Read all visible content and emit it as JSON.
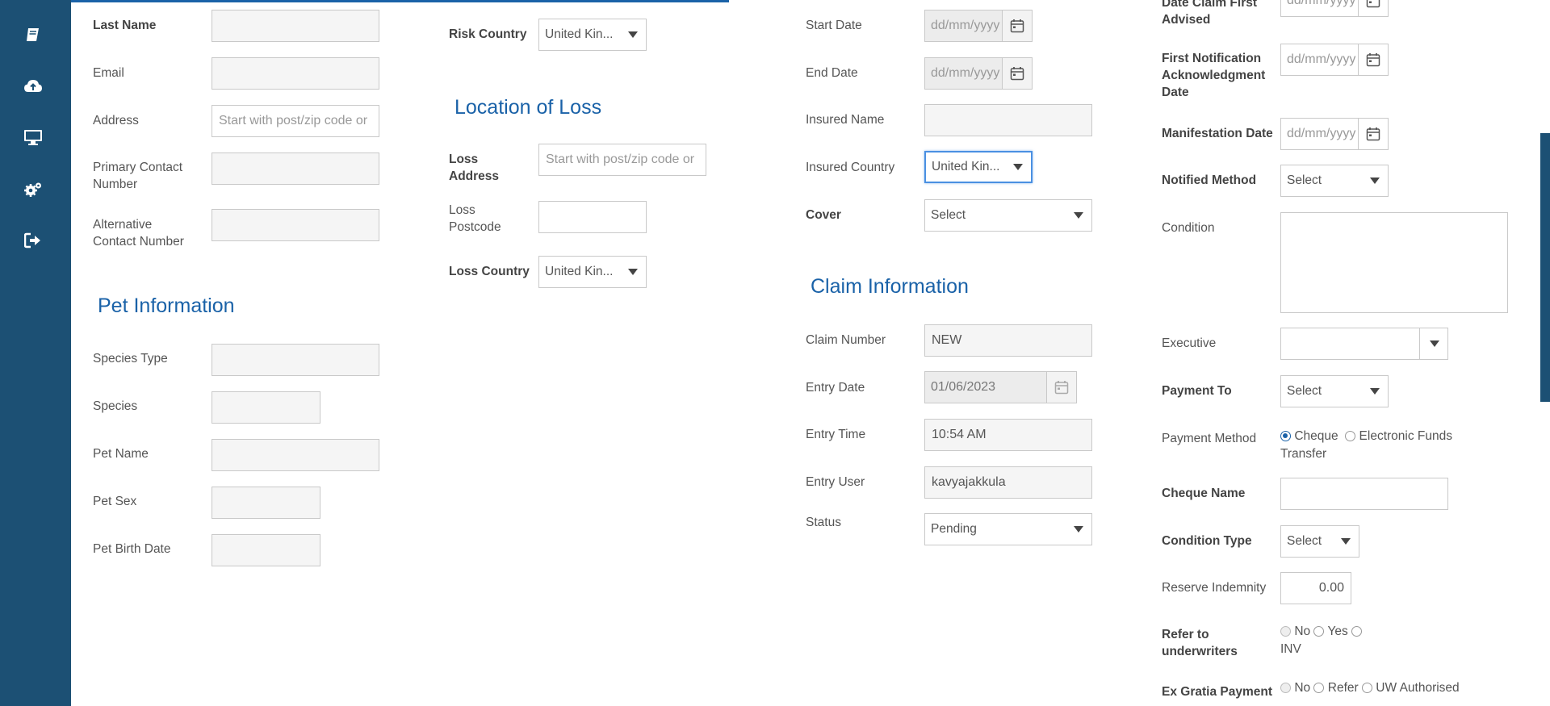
{
  "sidebar": {
    "items": [
      {
        "name": "claims-book-icon"
      },
      {
        "name": "cloud-upload-icon"
      },
      {
        "name": "monitor-icon"
      },
      {
        "name": "settings-gears-icon"
      },
      {
        "name": "sign-out-icon"
      }
    ]
  },
  "contact": {
    "last_name_label": "Last Name",
    "email_label": "Email",
    "address_label": "Address",
    "address_placeholder": "Start with post/zip code or",
    "primary_contact_label": "Primary Contact Number",
    "alternative_contact_label": "Alternative Contact Number"
  },
  "pet": {
    "title": "Pet Information",
    "species_type_label": "Species Type",
    "species_label": "Species",
    "pet_name_label": "Pet Name",
    "pet_sex_label": "Pet Sex",
    "pet_birth_date_label": "Pet Birth Date"
  },
  "risk": {
    "risk_country_label": "Risk Country",
    "risk_country_value": "United Kin..."
  },
  "loss": {
    "title": "Location of Loss",
    "loss_address_label": "Loss Address",
    "loss_address_placeholder": "Start with post/zip code or",
    "loss_postcode_label": "Loss Postcode",
    "loss_country_label": "Loss Country",
    "loss_country_value": "United Kin..."
  },
  "policy": {
    "start_date_label": "Start Date",
    "end_date_label": "End Date",
    "date_placeholder": "dd/mm/yyyy",
    "insured_name_label": "Insured Name",
    "insured_country_label": "Insured Country",
    "insured_country_value": "United Kin...",
    "cover_label": "Cover",
    "cover_value": "Select"
  },
  "claim": {
    "title": "Claim Information",
    "claim_number_label": "Claim Number",
    "claim_number_value": "NEW",
    "entry_date_label": "Entry Date",
    "entry_date_value": "01/06/2023",
    "entry_time_label": "Entry Time",
    "entry_time_value": "10:54 AM",
    "entry_user_label": "Entry User",
    "entry_user_value": "kavyajakkula",
    "status_label": "Status",
    "status_value": "Pending"
  },
  "right": {
    "date_claim_first_advised_label": "Date Claim First Advised",
    "first_notification_label": "First Notification Acknowledgment Date",
    "manifestation_date_label": "Manifestation Date",
    "date_placeholder": "dd/mm/yyyy",
    "notified_method_label": "Notified Method",
    "notified_method_value": "Select",
    "condition_label": "Condition",
    "executive_label": "Executive",
    "payment_to_label": "Payment To",
    "payment_to_value": "Select",
    "payment_method_label": "Payment Method",
    "payment_method_cheque": "Cheque",
    "payment_method_eft": "Electronic Funds Transfer",
    "cheque_name_label": "Cheque Name",
    "condition_type_label": "Condition Type",
    "condition_type_value": "Select",
    "reserve_indemnity_label": "Reserve Indemnity",
    "reserve_indemnity_value": "0.00",
    "refer_label": "Refer to underwriters",
    "refer_no": "No",
    "refer_yes": "Yes",
    "refer_inv": "INV",
    "ex_gratia_label": "Ex Gratia Payment",
    "ex_gratia_no": "No",
    "ex_gratia_refer": "Refer",
    "ex_gratia_uw": "UW Authorised"
  },
  "colors": {
    "sidebar": "#1c5074",
    "accent": "#1a62a8"
  }
}
